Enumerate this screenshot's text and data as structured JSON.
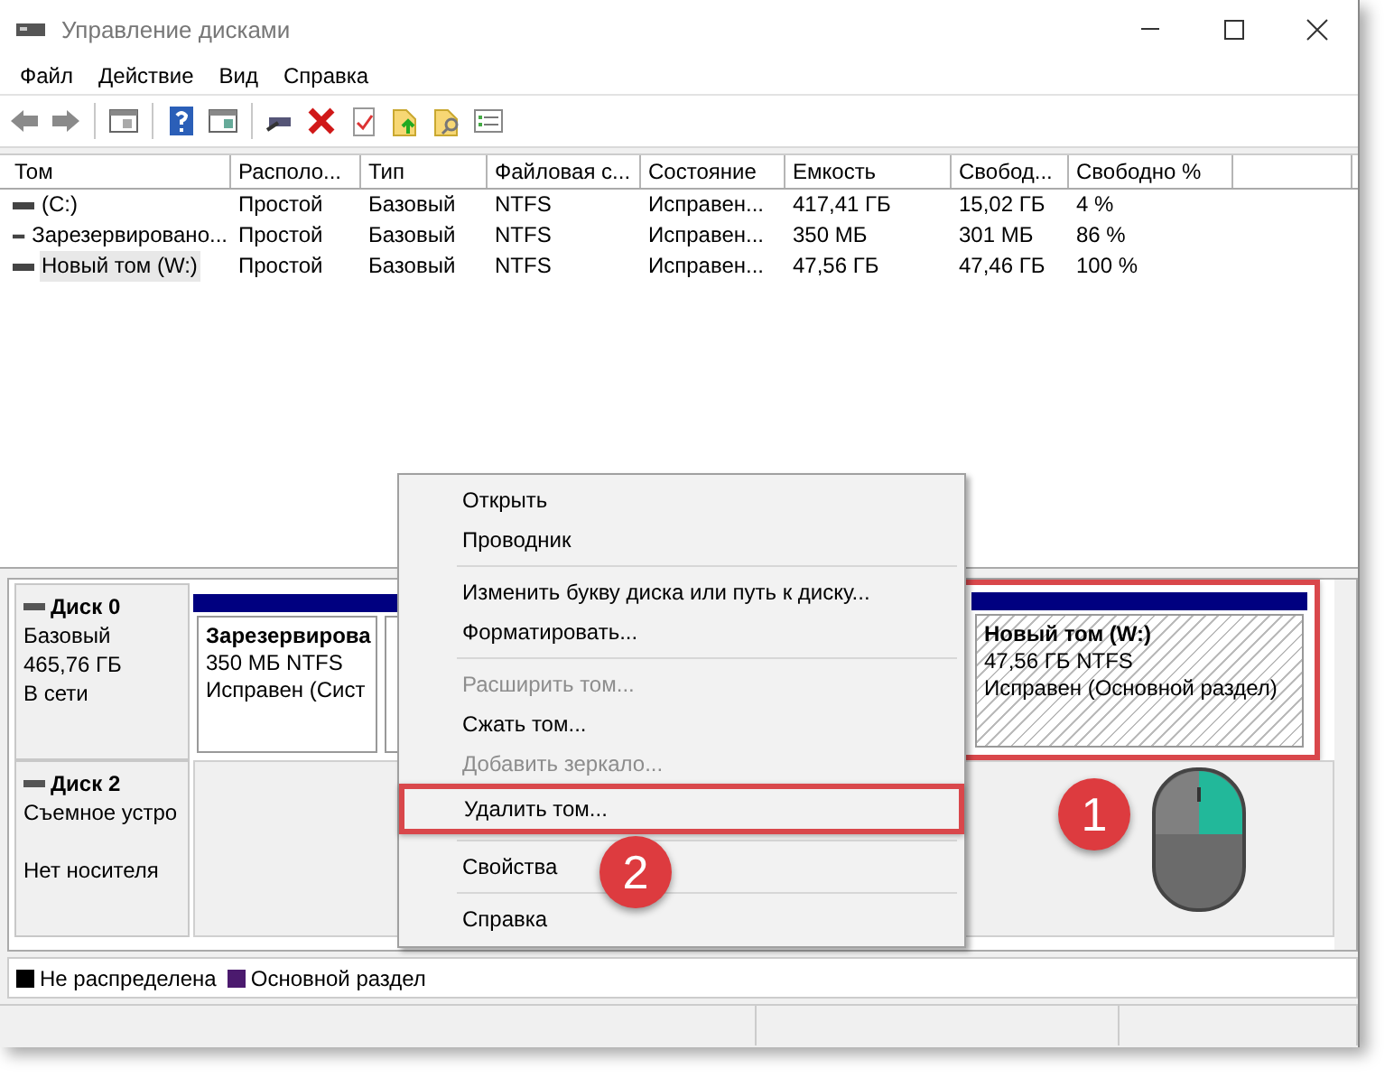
{
  "window": {
    "title": "Управление дисками"
  },
  "menu_bar": [
    "Файл",
    "Действие",
    "Вид",
    "Справка"
  ],
  "table": {
    "columns": [
      "Том",
      "Располо...",
      "Тип",
      "Файловая с...",
      "Состояние",
      "Емкость",
      "Свобод...",
      "Свободно %"
    ],
    "rows": [
      {
        "cells": [
          "(C:)",
          "Простой",
          "Базовый",
          "NTFS",
          "Исправен...",
          "417,41 ГБ",
          "15,02 ГБ",
          "4 %"
        ],
        "selected": false
      },
      {
        "cells": [
          "Зарезервировано...",
          "Простой",
          "Базовый",
          "NTFS",
          "Исправен...",
          "350 МБ",
          "301 МБ",
          "86 %"
        ],
        "selected": false
      },
      {
        "cells": [
          "Новый том (W:)",
          "Простой",
          "Базовый",
          "NTFS",
          "Исправен...",
          "47,56 ГБ",
          "47,46 ГБ",
          "100 %"
        ],
        "selected": true
      }
    ]
  },
  "disks": [
    {
      "name": "Диск 0",
      "details": [
        "Базовый",
        "465,76 ГБ",
        "В сети"
      ],
      "partitions": [
        {
          "title": "Зарезервирова",
          "size": "350 МБ NTFS",
          "status": "Исправен (Сист",
          "selected": false,
          "highlighted": false
        },
        {
          "title": "Новый том  (W:)",
          "size": "47,56 ГБ NTFS",
          "status": "Исправен (Основной раздел)",
          "selected": true,
          "highlighted": true
        }
      ]
    },
    {
      "name": "Диск 2",
      "details": [
        "Съемное устро",
        "Нет носителя"
      ]
    }
  ],
  "legend": [
    {
      "label": "Не распределена",
      "color": "#000000"
    },
    {
      "label": "Основной раздел",
      "color": "#4b1a6e"
    }
  ],
  "context_menu": {
    "groups": [
      [
        {
          "label": "Открыть",
          "disabled": false,
          "highlighted": false
        },
        {
          "label": "Проводник",
          "disabled": false,
          "highlighted": false
        }
      ],
      [
        {
          "label": "Изменить букву диска или путь к диску...",
          "disabled": false,
          "highlighted": false
        },
        {
          "label": "Форматировать...",
          "disabled": false,
          "highlighted": false
        }
      ],
      [
        {
          "label": "Расширить том...",
          "disabled": true,
          "highlighted": false
        },
        {
          "label": "Сжать том...",
          "disabled": false,
          "highlighted": false
        },
        {
          "label": "Добавить зеркало...",
          "disabled": true,
          "highlighted": false
        },
        {
          "label": "Удалить том...",
          "disabled": false,
          "highlighted": true
        }
      ],
      [
        {
          "label": "Свойства",
          "disabled": false,
          "highlighted": false
        }
      ],
      [
        {
          "label": "Справка",
          "disabled": false,
          "highlighted": false
        }
      ]
    ]
  },
  "markers": [
    {
      "number": "1"
    },
    {
      "number": "2"
    }
  ]
}
